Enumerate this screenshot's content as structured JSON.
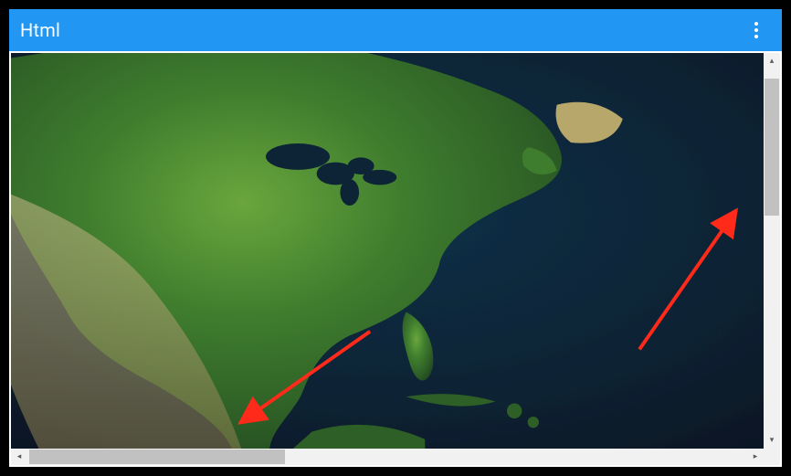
{
  "header": {
    "title": "Html",
    "menu_icon": "more-vert-icon"
  },
  "content": {
    "type": "html-scroll-panel",
    "image_description": "Satellite-style map view of North America: green landmass (US, Canada, Mexico, Central America, Caribbean) over dark-blue ocean.",
    "scroll": {
      "vertical": {
        "visible": true,
        "thumb_position": "near-top"
      },
      "horizontal": {
        "visible": true,
        "thumb_position": "near-left"
      }
    }
  },
  "annotations": {
    "arrows": [
      {
        "name": "arrow-to-horizontal-scrollbar",
        "color": "#ff2a1a"
      },
      {
        "name": "arrow-to-vertical-scrollbar",
        "color": "#ff2a1a"
      }
    ]
  }
}
